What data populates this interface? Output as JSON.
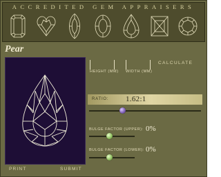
{
  "header": {
    "title": "ACCREDITED GEM APPRAISERS"
  },
  "shapes": [
    {
      "name": "emerald"
    },
    {
      "name": "heart"
    },
    {
      "name": "marquise"
    },
    {
      "name": "oval"
    },
    {
      "name": "pear"
    },
    {
      "name": "princess"
    },
    {
      "name": "round"
    }
  ],
  "selected_shape": "Pear",
  "inputs": {
    "height_value": "",
    "height_label": "HEIGHT (MM)",
    "width_value": "",
    "width_label": "WIDTH (MM)"
  },
  "calculate_label": "CALCULATE",
  "ratio": {
    "label": "RATIO:",
    "value": "1.62:1",
    "slider_fraction": 0.3
  },
  "bulge_upper": {
    "label": "BULGE FACTOR (UPPER):",
    "value": "0%",
    "slider_fraction": 0.45
  },
  "bulge_lower": {
    "label": "BULGE FACTOR (LOWER):",
    "value": "0%",
    "slider_fraction": 0.45
  },
  "actions": {
    "print_label": "PRINT",
    "submit_label": "SUBMIT"
  },
  "colors": {
    "background": "#6b6a44",
    "header": "#4e4c2d",
    "display": "#1e0e36",
    "line": "#f0ecd8"
  }
}
